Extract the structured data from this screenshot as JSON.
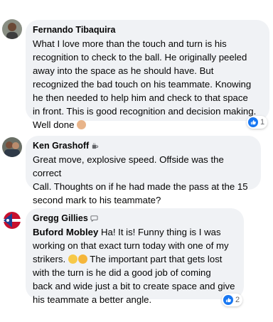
{
  "comments": [
    {
      "author": "Fernando Tibaquira",
      "lines": [
        "What I love more than the touch and turn is his",
        "recognition to check to the ball. He originally peeled",
        "away into the space as he should have. But",
        "recognized the bad touch on his teammate. Knowing",
        "he then needed to help him and check to that space",
        "in front. This is good recognition and decision making.",
        "Well done"
      ],
      "reaction_count": "1"
    },
    {
      "author": "Ken Grashoff",
      "author_badge_icon": "coffee-cup-icon",
      "lines": [
        "Great move, explosive speed. Offside was the correct",
        "Call. Thoughts on if he had made the pass at the 15",
        "second mark to his teammate?"
      ]
    },
    {
      "author": "Gregg Gillies",
      "author_badge_icon": "speech-bubble-icon",
      "mention": "Buford Mobley",
      "first_line_rest": " Ha! It is! Funny thing is I was",
      "lines": [
        "working on that exact turn today with one of my",
        "strikers.",
        "The important part that gets lost",
        "with the turn is he did a good job of coming",
        "back and wide just a bit to create space and give",
        "his teammate a better angle."
      ],
      "reaction_count": "2"
    }
  ],
  "colors": {
    "bubble_bg": "#f0f2f5",
    "text": "#050505",
    "secondary_text": "#65676b",
    "like_blue": "#1877f2"
  }
}
